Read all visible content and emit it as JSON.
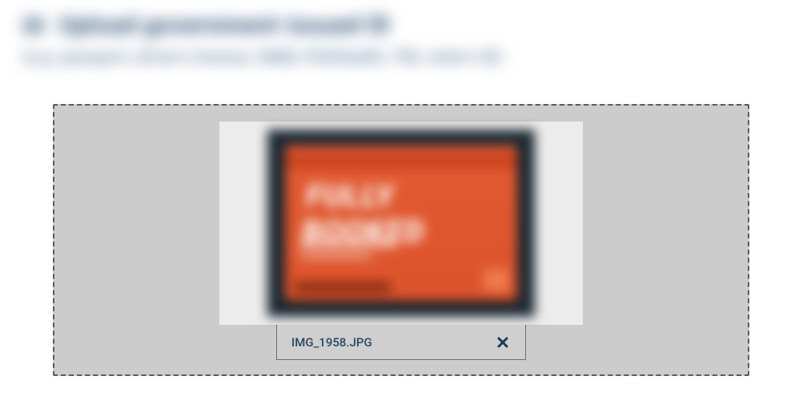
{
  "header": {
    "badge_label": "ID",
    "title": "Upload government-issued ID",
    "subtitle": "(e.g. passport, driver's license, UMID, PhilHealth, TIN, voter's ID)"
  },
  "upload": {
    "file_name": "IMG_1958.JPG",
    "card_preview_text": "FULLY BOOKED"
  },
  "icons": {
    "remove": "close-icon"
  }
}
